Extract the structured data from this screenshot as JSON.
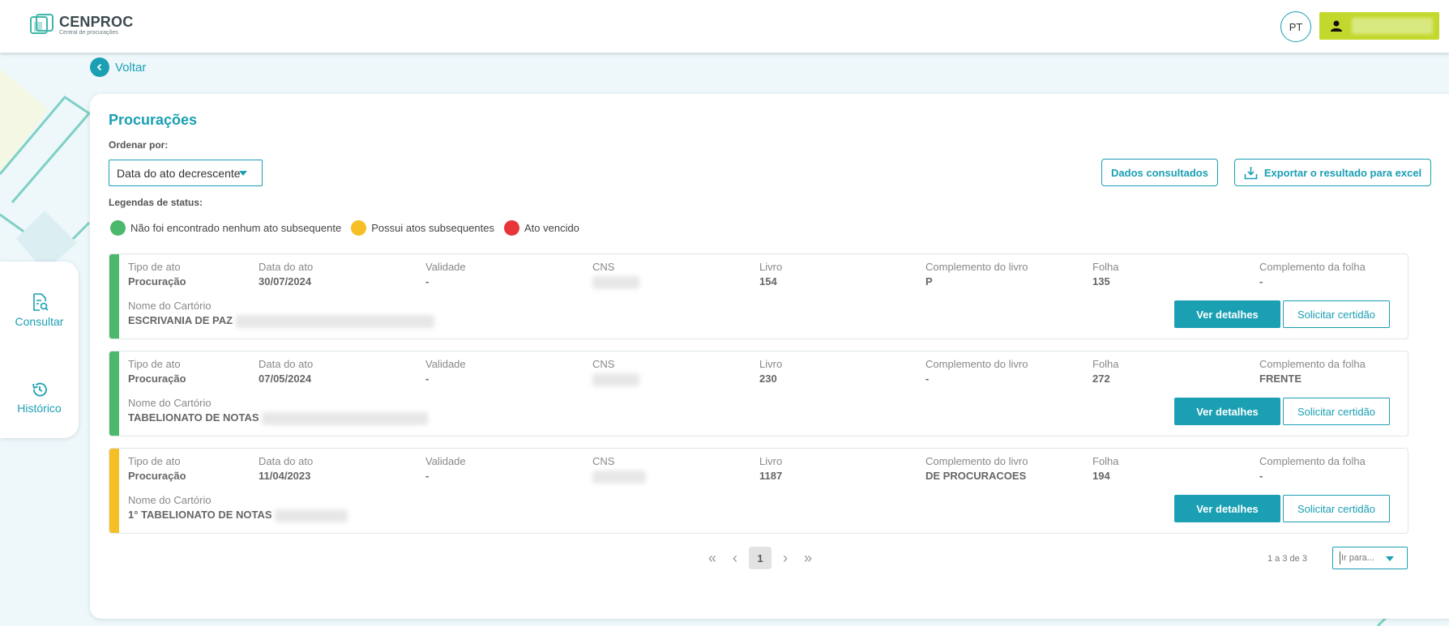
{
  "header": {
    "logo_title": "CENPROC",
    "logo_subtitle": "Central de procurações",
    "lang": "PT",
    "user_icon": "user-icon"
  },
  "sidebar": {
    "items": [
      {
        "label": "Consultar",
        "icon": "document-search-icon"
      },
      {
        "label": "Histórico",
        "icon": "history-icon"
      }
    ]
  },
  "back": {
    "label": "Voltar"
  },
  "main": {
    "title": "Procurações",
    "order_label": "Ordenar por:",
    "order_value": "Data do ato decrescente",
    "btn_dados": "Dados consultados",
    "btn_export": "Exportar o resultado para excel",
    "legend_label": "Legendas de status:",
    "legend": [
      {
        "label": "Não foi encontrado nenhum ato subsequente",
        "color": "#4cb86b"
      },
      {
        "label": "Possui atos subsequentes",
        "color": "#f6bf26"
      },
      {
        "label": "Ato vencido",
        "color": "#e8353a"
      }
    ]
  },
  "columns": {
    "tipo": "Tipo de ato",
    "data": "Data do ato",
    "validade": "Validade",
    "cns": "CNS",
    "livro": "Livro",
    "comp_livro": "Complemento do livro",
    "folha": "Folha",
    "comp_folha": "Complemento da folha",
    "cartorio": "Nome do Cartório"
  },
  "records": [
    {
      "status_color": "#4cb86b",
      "tipo": "Procuração",
      "data": "30/07/2024",
      "validade": "-",
      "livro": "154",
      "comp_livro": "P",
      "folha": "135",
      "comp_folha": "-",
      "cartorio": "ESCRIVANIA DE PAZ",
      "btn_detalhes": "Ver detalhes",
      "btn_certidao": "Solicitar certidão"
    },
    {
      "status_color": "#4cb86b",
      "tipo": "Procuração",
      "data": "07/05/2024",
      "validade": "-",
      "livro": "230",
      "comp_livro": "-",
      "folha": "272",
      "comp_folha": "FRENTE",
      "cartorio": "TABELIONATO DE NOTAS",
      "btn_detalhes": "Ver detalhes",
      "btn_certidao": "Solicitar certidão"
    },
    {
      "status_color": "#f6bf26",
      "tipo": "Procuração",
      "data": "11/04/2023",
      "validade": "-",
      "livro": "1187",
      "comp_livro": "DE PROCURACOES",
      "folha": "194",
      "comp_folha": "-",
      "cartorio": "1° TABELIONATO DE NOTAS",
      "btn_detalhes": "Ver detalhes",
      "btn_certidao": "Solicitar certidão"
    }
  ],
  "pagination": {
    "current": "1",
    "range": "1 a 3 de 3",
    "goto_placeholder": "Ir para..."
  }
}
